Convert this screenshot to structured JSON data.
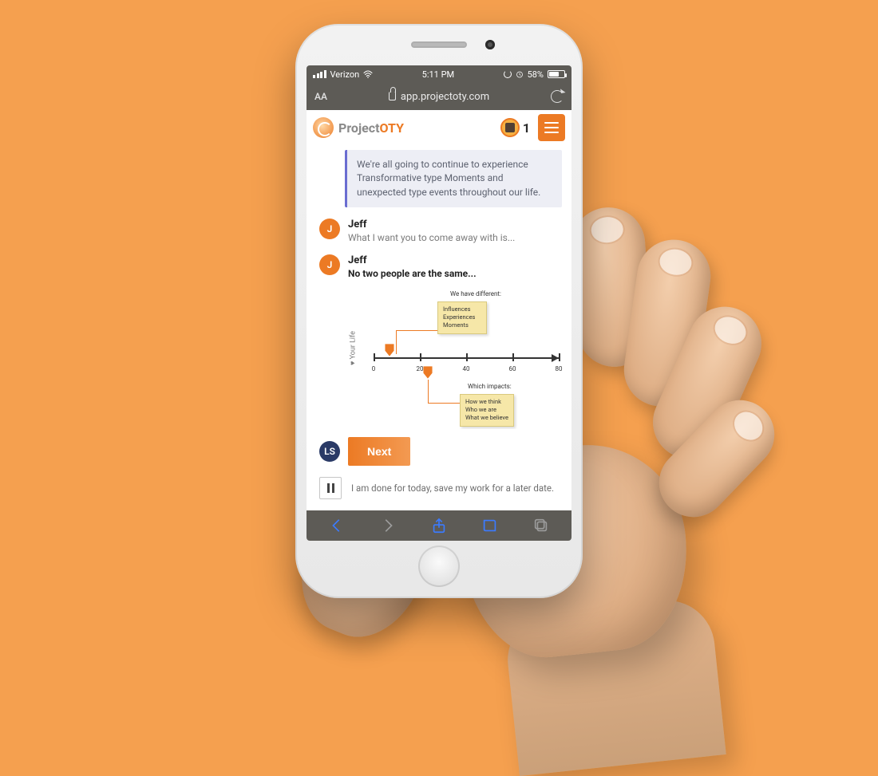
{
  "statusbar": {
    "carrier": "Verizon",
    "time": "5:11 PM",
    "battery_pct": "58%"
  },
  "safari": {
    "aa_label": "AA",
    "url": "app.projectoty.com"
  },
  "app": {
    "brand": {
      "part1": "Project",
      "part2": "OTY"
    },
    "notif_count": "1",
    "callout": "We're all going to continue to experience Transformative type Moments and unexpected type events throughout our life.",
    "messages": [
      {
        "avatar": "J",
        "name": "Jeff",
        "text": "What I want you to come away with is..."
      },
      {
        "avatar": "J",
        "name": "Jeff",
        "text": "No two people are the same..."
      }
    ],
    "diagram": {
      "y_label": "Your Life",
      "ticks": [
        "0",
        "20",
        "40",
        "60",
        "80"
      ],
      "note_top_title": "We have different:",
      "note_top_lines": [
        "Influences",
        "Experiences",
        "Moments"
      ],
      "note_bottom_title": "Which impacts:",
      "note_bottom_lines": [
        "How we think",
        "Who we are",
        "What we believe"
      ]
    },
    "footer": {
      "ls": "LS",
      "next": "Next",
      "save_text": "I am done for today, save my work for a later date."
    }
  }
}
